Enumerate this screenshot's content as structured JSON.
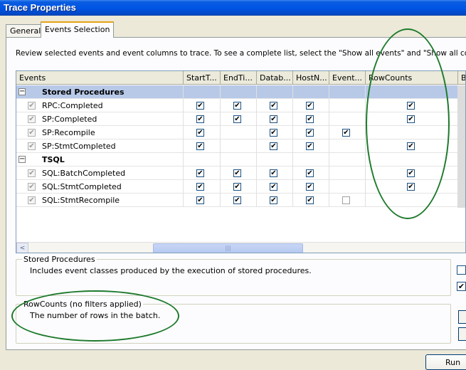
{
  "window": {
    "title": "Trace Properties"
  },
  "tabs": [
    {
      "label": "General",
      "active": false
    },
    {
      "label": "Events Selection",
      "active": true
    }
  ],
  "description": "Review selected events and event columns to trace. To see a complete list, select the \"Show all events\" and \"Show all columns\" opti",
  "grid": {
    "columns": [
      "Events",
      "StartT...",
      "EndTi...",
      "Datab...",
      "HostN...",
      "Event...",
      "RowCounts",
      "B"
    ],
    "categories": [
      {
        "label": "Stored Procedures",
        "expander": "−",
        "selected": true,
        "events": [
          {
            "label": "RPC:Completed",
            "checks": [
              true,
              true,
              true,
              true,
              null,
              true
            ]
          },
          {
            "label": "SP:Completed",
            "checks": [
              true,
              true,
              true,
              true,
              null,
              true
            ]
          },
          {
            "label": "SP:Recompile",
            "checks": [
              true,
              null,
              true,
              true,
              true,
              null
            ]
          },
          {
            "label": "SP:StmtCompleted",
            "checks": [
              true,
              null,
              true,
              true,
              null,
              true
            ]
          }
        ]
      },
      {
        "label": "TSQL",
        "expander": "−",
        "selected": false,
        "events": [
          {
            "label": "SQL:BatchCompleted",
            "checks": [
              true,
              true,
              true,
              true,
              null,
              true
            ]
          },
          {
            "label": "SQL:StmtCompleted",
            "checks": [
              true,
              true,
              true,
              true,
              null,
              true
            ]
          },
          {
            "label": "SQL:StmtRecompile",
            "checks": [
              true,
              true,
              true,
              true,
              false,
              null
            ]
          }
        ]
      }
    ],
    "check_glyph": "✔",
    "scroll_left_glyph": "<",
    "scroll_thumb_glyph": "|||"
  },
  "event_info": {
    "title": "Stored Procedures",
    "text": "Includes event classes produced by the execution of stored procedures."
  },
  "column_info": {
    "title": "RowCounts (no filters applied)",
    "text": "The number of rows in the batch."
  },
  "buttons": {
    "run": "Run"
  },
  "colors": {
    "annotation": "#1e7a2c",
    "titlebar": "#0055e5",
    "selection": "#b8c9e8"
  }
}
